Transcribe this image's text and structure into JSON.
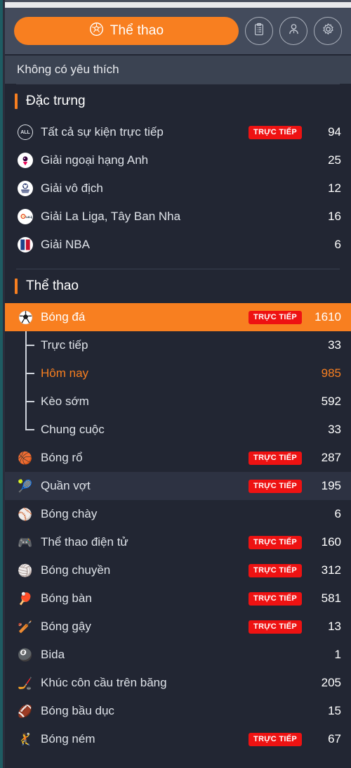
{
  "header": {
    "sport_tab_label": "Thể thao",
    "sport_tab_icon": "soccer-ball-icon",
    "buttons": [
      {
        "name": "bet-slip-button",
        "icon": "clipboard-icon"
      },
      {
        "name": "account-button",
        "icon": "user-icon"
      },
      {
        "name": "settings-button",
        "icon": "gear-icon"
      }
    ],
    "accent_color": "#f87f20"
  },
  "favorites": {
    "empty_text": "Không có yêu thích"
  },
  "featured": {
    "title": "Đặc trưng",
    "items": [
      {
        "icon": "all-events-icon",
        "label": "Tất cả sự kiện trực tiếp",
        "live": "TRỰC TIẾP",
        "count": "94"
      },
      {
        "icon": "premier-league-icon",
        "label": "Giải ngoại hạng Anh",
        "live": "",
        "count": "25"
      },
      {
        "icon": "champions-league-icon",
        "label": "Giải vô địch",
        "live": "",
        "count": "12"
      },
      {
        "icon": "la-liga-icon",
        "label": "Giải La Liga, Tây Ban Nha",
        "live": "",
        "count": "16"
      },
      {
        "icon": "nba-icon",
        "label": "Giải NBA",
        "live": "",
        "count": "6"
      }
    ]
  },
  "sports": {
    "title": "Thể thao",
    "football": {
      "icon": "soccer-ball-icon",
      "label": "Bóng đá",
      "live": "TRỰC TIẾP",
      "count": "1610",
      "selected": true,
      "children": [
        {
          "label": "Trực tiếp",
          "count": "33",
          "active": false
        },
        {
          "label": "Hôm nay",
          "count": "985",
          "active": true
        },
        {
          "label": "Kèo sớm",
          "count": "592",
          "active": false
        },
        {
          "label": "Chung cuộc",
          "count": "33",
          "active": false
        }
      ]
    },
    "items": [
      {
        "icon": "basketball-icon",
        "label": "Bóng rổ",
        "live": "TRỰC TIẾP",
        "count": "287",
        "hovered": false
      },
      {
        "icon": "tennis-ball-icon",
        "label": "Quần vợt",
        "live": "TRỰC TIẾP",
        "count": "195",
        "hovered": true
      },
      {
        "icon": "baseball-icon",
        "label": "Bóng chày",
        "live": "",
        "count": "6",
        "hovered": false
      },
      {
        "icon": "gamepad-icon",
        "label": "Thể thao điện tử",
        "live": "TRỰC TIẾP",
        "count": "160",
        "hovered": false
      },
      {
        "icon": "volleyball-icon",
        "label": "Bóng chuyền",
        "live": "TRỰC TIẾP",
        "count": "312",
        "hovered": false
      },
      {
        "icon": "pingpong-icon",
        "label": "Bóng bàn",
        "live": "TRỰC TIẾP",
        "count": "581",
        "hovered": false
      },
      {
        "icon": "cricket-icon",
        "label": "Bóng gậy",
        "live": "TRỰC TIẾP",
        "count": "13",
        "hovered": false
      },
      {
        "icon": "billiards-icon",
        "label": "Bida",
        "live": "",
        "count": "1",
        "hovered": false
      },
      {
        "icon": "ice-hockey-icon",
        "label": "Khúc côn cầu trên băng",
        "live": "",
        "count": "205",
        "hovered": false
      },
      {
        "icon": "rugby-icon",
        "label": "Bóng bầu dục",
        "live": "",
        "count": "15",
        "hovered": false
      },
      {
        "icon": "handball-icon",
        "label": "Bóng ném",
        "live": "TRỰC TIẾP",
        "count": "67",
        "hovered": false
      }
    ]
  },
  "colors": {
    "accent": "#f87f20",
    "live_badge": "#ee1212",
    "background": "#222633",
    "header_bar": "#434b5c",
    "favorites_bar": "#3b4352"
  },
  "icon_glyphs": {
    "soccer-ball-icon": "⚽",
    "basketball-icon": "🏀",
    "tennis-ball-icon": "🎾",
    "baseball-icon": "⚾",
    "gamepad-icon": "🎮",
    "volleyball-icon": "🏐",
    "pingpong-icon": "🏓",
    "cricket-icon": "🏏",
    "billiards-icon": "🎱",
    "ice-hockey-icon": "🏒",
    "rugby-icon": "🏈",
    "handball-icon": "🤾"
  }
}
